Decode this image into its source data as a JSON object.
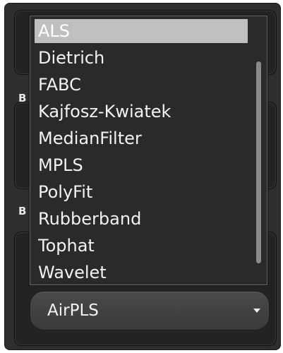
{
  "labels": {
    "section_1": "B",
    "section_2": "B"
  },
  "dropdown": {
    "options": [
      "ALS",
      "Dietrich",
      "FABC",
      "Kajfosz-Kwiatek",
      "MedianFilter",
      "MPLS",
      "PolyFit",
      "Rubberband",
      "Tophat",
      "Wavelet"
    ],
    "highlighted": "ALS"
  },
  "combobox": {
    "value": "AirPLS"
  }
}
